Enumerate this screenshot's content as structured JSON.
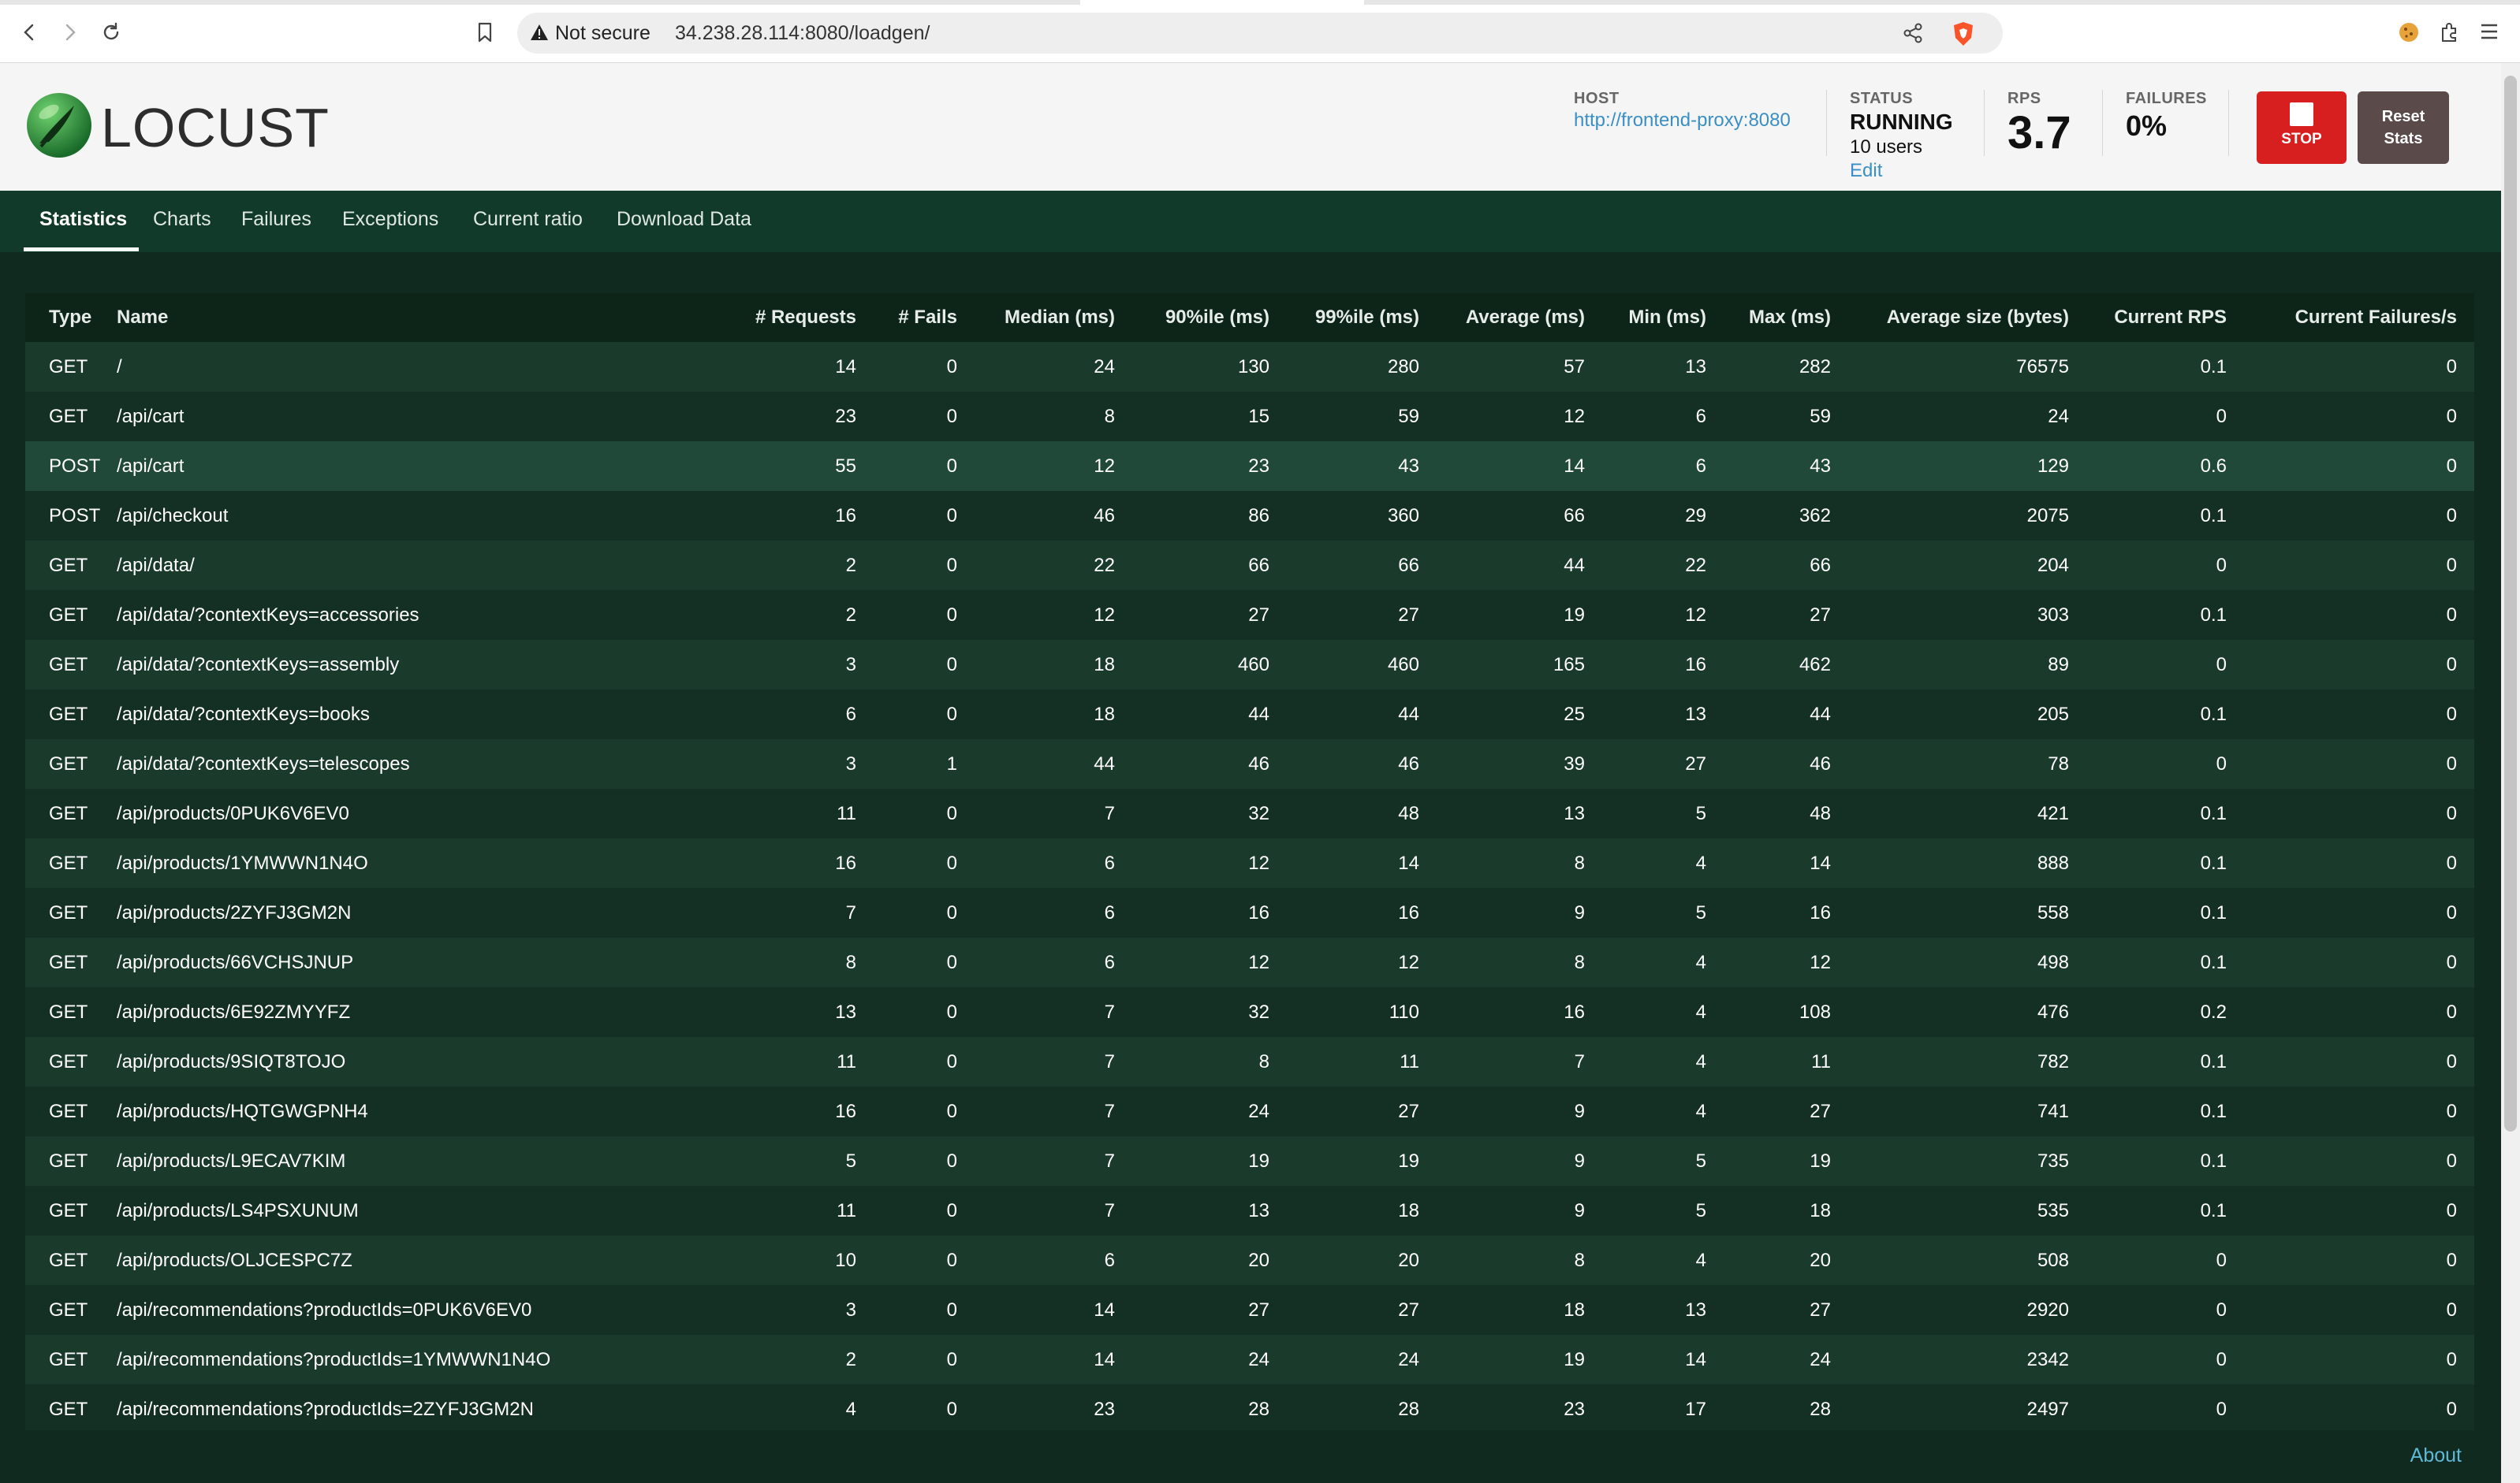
{
  "browser": {
    "security_label": "Not secure",
    "url": "34.238.28.114:8080/loadgen/"
  },
  "app": {
    "logo_text": "LOCUST",
    "host_label": "HOST",
    "host_value": "http://frontend-proxy:8080",
    "status_label": "STATUS",
    "status_value": "RUNNING",
    "users": "10 users",
    "edit_label": "Edit",
    "rps_label": "RPS",
    "rps_value": "3.7",
    "failures_label": "FAILURES",
    "failures_value": "0%",
    "stop_label": "STOP",
    "reset_label_1": "Reset",
    "reset_label_2": "Stats"
  },
  "tabs": [
    "Statistics",
    "Charts",
    "Failures",
    "Exceptions",
    "Current ratio",
    "Download Data"
  ],
  "table": {
    "columns": [
      "Type",
      "Name",
      "# Requests",
      "# Fails",
      "Median (ms)",
      "90%ile (ms)",
      "99%ile (ms)",
      "Average (ms)",
      "Min (ms)",
      "Max (ms)",
      "Average size (bytes)",
      "Current RPS",
      "Current Failures/s"
    ],
    "rows": [
      [
        "GET",
        "/",
        "14",
        "0",
        "24",
        "130",
        "280",
        "57",
        "13",
        "282",
        "76575",
        "0.1",
        "0"
      ],
      [
        "GET",
        "/api/cart",
        "23",
        "0",
        "8",
        "15",
        "59",
        "12",
        "6",
        "59",
        "24",
        "0",
        "0"
      ],
      [
        "POST",
        "/api/cart",
        "55",
        "0",
        "12",
        "23",
        "43",
        "14",
        "6",
        "43",
        "129",
        "0.6",
        "0"
      ],
      [
        "POST",
        "/api/checkout",
        "16",
        "0",
        "46",
        "86",
        "360",
        "66",
        "29",
        "362",
        "2075",
        "0.1",
        "0"
      ],
      [
        "GET",
        "/api/data/",
        "2",
        "0",
        "22",
        "66",
        "66",
        "44",
        "22",
        "66",
        "204",
        "0",
        "0"
      ],
      [
        "GET",
        "/api/data/?contextKeys=accessories",
        "2",
        "0",
        "12",
        "27",
        "27",
        "19",
        "12",
        "27",
        "303",
        "0.1",
        "0"
      ],
      [
        "GET",
        "/api/data/?contextKeys=assembly",
        "3",
        "0",
        "18",
        "460",
        "460",
        "165",
        "16",
        "462",
        "89",
        "0",
        "0"
      ],
      [
        "GET",
        "/api/data/?contextKeys=books",
        "6",
        "0",
        "18",
        "44",
        "44",
        "25",
        "13",
        "44",
        "205",
        "0.1",
        "0"
      ],
      [
        "GET",
        "/api/data/?contextKeys=telescopes",
        "3",
        "1",
        "44",
        "46",
        "46",
        "39",
        "27",
        "46",
        "78",
        "0",
        "0"
      ],
      [
        "GET",
        "/api/products/0PUK6V6EV0",
        "11",
        "0",
        "7",
        "32",
        "48",
        "13",
        "5",
        "48",
        "421",
        "0.1",
        "0"
      ],
      [
        "GET",
        "/api/products/1YMWWN1N4O",
        "16",
        "0",
        "6",
        "12",
        "14",
        "8",
        "4",
        "14",
        "888",
        "0.1",
        "0"
      ],
      [
        "GET",
        "/api/products/2ZYFJ3GM2N",
        "7",
        "0",
        "6",
        "16",
        "16",
        "9",
        "5",
        "16",
        "558",
        "0.1",
        "0"
      ],
      [
        "GET",
        "/api/products/66VCHSJNUP",
        "8",
        "0",
        "6",
        "12",
        "12",
        "8",
        "4",
        "12",
        "498",
        "0.1",
        "0"
      ],
      [
        "GET",
        "/api/products/6E92ZMYYFZ",
        "13",
        "0",
        "7",
        "32",
        "110",
        "16",
        "4",
        "108",
        "476",
        "0.2",
        "0"
      ],
      [
        "GET",
        "/api/products/9SIQT8TOJO",
        "11",
        "0",
        "7",
        "8",
        "11",
        "7",
        "4",
        "11",
        "782",
        "0.1",
        "0"
      ],
      [
        "GET",
        "/api/products/HQTGWGPNH4",
        "16",
        "0",
        "7",
        "24",
        "27",
        "9",
        "4",
        "27",
        "741",
        "0.1",
        "0"
      ],
      [
        "GET",
        "/api/products/L9ECAV7KIM",
        "5",
        "0",
        "7",
        "19",
        "19",
        "9",
        "5",
        "19",
        "735",
        "0.1",
        "0"
      ],
      [
        "GET",
        "/api/products/LS4PSXUNUM",
        "11",
        "0",
        "7",
        "13",
        "18",
        "9",
        "5",
        "18",
        "535",
        "0.1",
        "0"
      ],
      [
        "GET",
        "/api/products/OLJCESPC7Z",
        "10",
        "0",
        "6",
        "20",
        "20",
        "8",
        "4",
        "20",
        "508",
        "0",
        "0"
      ],
      [
        "GET",
        "/api/recommendations?productIds=0PUK6V6EV0",
        "3",
        "0",
        "14",
        "27",
        "27",
        "18",
        "13",
        "27",
        "2920",
        "0",
        "0"
      ],
      [
        "GET",
        "/api/recommendations?productIds=1YMWWN1N4O",
        "2",
        "0",
        "14",
        "24",
        "24",
        "19",
        "14",
        "24",
        "2342",
        "0",
        "0"
      ],
      [
        "GET",
        "/api/recommendations?productIds=2ZYFJ3GM2N",
        "4",
        "0",
        "23",
        "28",
        "28",
        "23",
        "17",
        "28",
        "2497",
        "0",
        "0"
      ]
    ]
  },
  "footer": {
    "about": "About"
  }
}
